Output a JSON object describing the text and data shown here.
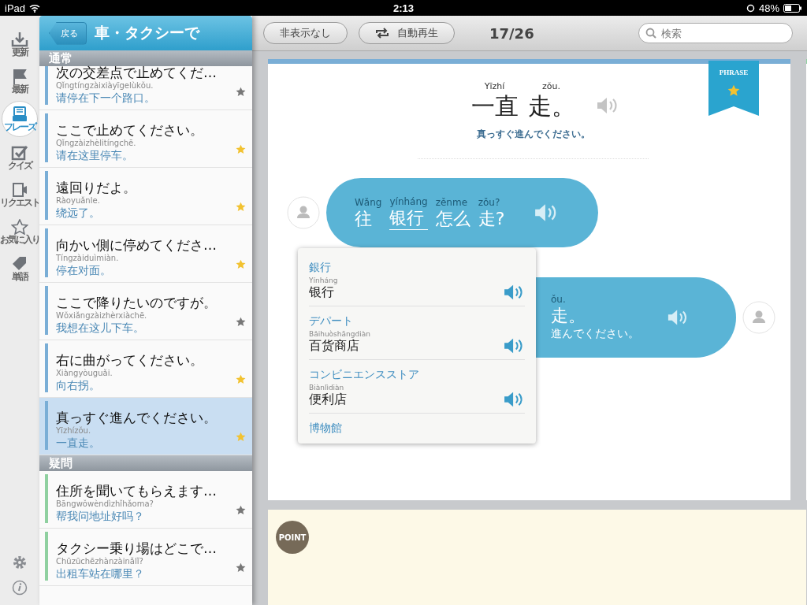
{
  "status_bar": {
    "device": "iPad",
    "time": "2:13",
    "battery": "48%"
  },
  "rail": {
    "items": [
      {
        "kind": "download",
        "label": "更新",
        "selected": false
      },
      {
        "kind": "flag",
        "label": "最新",
        "selected": false
      },
      {
        "kind": "book",
        "label": "フレーズ",
        "selected": true
      },
      {
        "kind": "check",
        "label": "クイズ",
        "selected": false
      },
      {
        "kind": "request",
        "label": "リクエスト",
        "selected": false
      },
      {
        "kind": "star",
        "label": "お気に入り",
        "selected": false
      },
      {
        "kind": "tag",
        "label": "単語",
        "selected": false
      }
    ]
  },
  "sidebar": {
    "back": "戻る",
    "title": "車・タクシーで",
    "sections": [
      {
        "title": "通常",
        "color": "#7aaed6",
        "rows": [
          {
            "title": "次の交差点で止めてくだ…",
            "pinyin": "Qǐngtíngzàixiàyīgelùkǒu.",
            "chinese": "请停在下一个路口。",
            "starred": false,
            "selected": false
          },
          {
            "title": "ここで止めてください。",
            "pinyin": "Qǐngzàizhèlitíngchē.",
            "chinese": "请在这里停车。",
            "starred": true,
            "selected": false
          },
          {
            "title": "遠回りだよ。",
            "pinyin": "Ràoyuǎnle.",
            "chinese": "绕远了。",
            "starred": true,
            "selected": false
          },
          {
            "title": "向かい側に停めてくださ…",
            "pinyin": "Tíngzàiduìmiàn.",
            "chinese": "停在对面。",
            "starred": true,
            "selected": false
          },
          {
            "title": "ここで降りたいのですが。",
            "pinyin": "Wǒxiǎngzàizhèrxiàchē.",
            "chinese": "我想在这儿下车。",
            "starred": false,
            "selected": false
          },
          {
            "title": "右に曲がってください。",
            "pinyin": "Xiàngyòuguǎi.",
            "chinese": "向右拐。",
            "starred": true,
            "selected": false
          },
          {
            "title": "真っすぐ進んでください。",
            "pinyin": "Yīzhízǒu.",
            "chinese": "一直走。",
            "starred": true,
            "selected": true
          }
        ]
      },
      {
        "title": "疑問",
        "color": "#8fd0a0",
        "rows": [
          {
            "title": "住所を聞いてもらえます…",
            "pinyin": "Bāngwǒwèndìzhǐhǎoma?",
            "chinese": "帮我问地址好吗？",
            "starred": false,
            "selected": false
          },
          {
            "title": "タクシー乗り場はどこで…",
            "pinyin": "Chūzūchēzhànzàinǎlǐ?",
            "chinese": "出租车站在哪里？",
            "starred": false,
            "selected": false
          }
        ]
      }
    ]
  },
  "toolbar": {
    "hide_button": "非表示なし",
    "autoplay_button": "自動再生",
    "counter": "17/26",
    "search": {
      "placeholder": "検索"
    }
  },
  "card": {
    "badge": "PHRASE",
    "words": [
      {
        "pinyin": "Yīzhí",
        "hanzi": "一直"
      },
      {
        "pinyin": "zǒu.",
        "hanzi": "走。"
      }
    ],
    "translation": "真っすぐ進んでください。",
    "bubbles": [
      {
        "kind": "received",
        "words": [
          {
            "pinyin": "Wǎng",
            "hanzi": "往",
            "selected": false
          },
          {
            "pinyin": "yínháng",
            "hanzi": "银行",
            "selected": true
          },
          {
            "pinyin": "zěnme",
            "hanzi": "怎么",
            "selected": false
          },
          {
            "pinyin": "zǒu?",
            "hanzi": "走?",
            "selected": false
          }
        ]
      },
      {
        "kind": "sent",
        "words": [
          {
            "pinyin": "ǒu.",
            "hanzi": "走。",
            "selected": false
          }
        ],
        "translation": "進んでください。"
      }
    ]
  },
  "popover": {
    "items": [
      {
        "japanese": "銀行",
        "pinyin": "Yínháng",
        "chinese": "银行"
      },
      {
        "japanese": "デパート",
        "pinyin": "Bǎihuòshāngdiàn",
        "chinese": "百货商店"
      },
      {
        "japanese": "コンビニエンスストア",
        "pinyin": "Biànlìdiàn",
        "chinese": "便利店"
      },
      {
        "japanese": "博物館"
      }
    ]
  },
  "note": {
    "badge": "POINT"
  }
}
